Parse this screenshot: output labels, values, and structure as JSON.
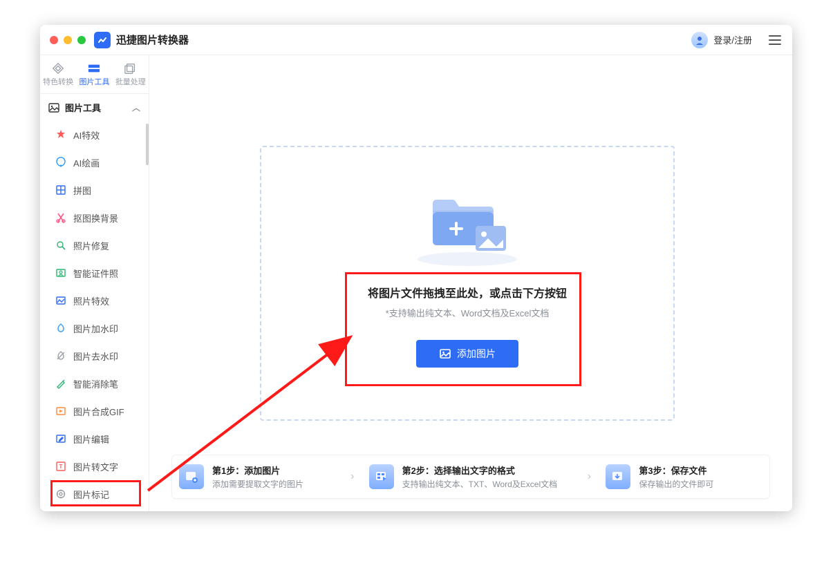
{
  "header": {
    "app_title": "迅捷图片转换器",
    "login_label": "登录/注册"
  },
  "top_tabs": [
    {
      "label": "特色转换"
    },
    {
      "label": "图片工具"
    },
    {
      "label": "批量处理"
    }
  ],
  "sidebar": {
    "section_title": "图片工具",
    "items": [
      {
        "label": "AI特效"
      },
      {
        "label": "AI绘画"
      },
      {
        "label": "拼图"
      },
      {
        "label": "抠图换背景"
      },
      {
        "label": "照片修复"
      },
      {
        "label": "智能证件照"
      },
      {
        "label": "照片特效"
      },
      {
        "label": "图片加水印"
      },
      {
        "label": "图片去水印"
      },
      {
        "label": "智能消除笔"
      },
      {
        "label": "图片合成GIF"
      },
      {
        "label": "图片编辑"
      },
      {
        "label": "图片转文字"
      },
      {
        "label": "图片标记"
      }
    ]
  },
  "dropzone": {
    "heading": "将图片文件拖拽至此处，或点击下方按钮",
    "subtext": "*支持输出纯文本、Word文档及Excel文档",
    "button_label": "添加图片"
  },
  "steps": [
    {
      "title": "第1步：添加图片",
      "desc": "添加需要提取文字的图片"
    },
    {
      "title": "第2步：选择输出文字的格式",
      "desc": "支持输出纯文本、TXT、Word及Excel文档"
    },
    {
      "title": "第3步：保存文件",
      "desc": "保存输出的文件即可"
    }
  ]
}
